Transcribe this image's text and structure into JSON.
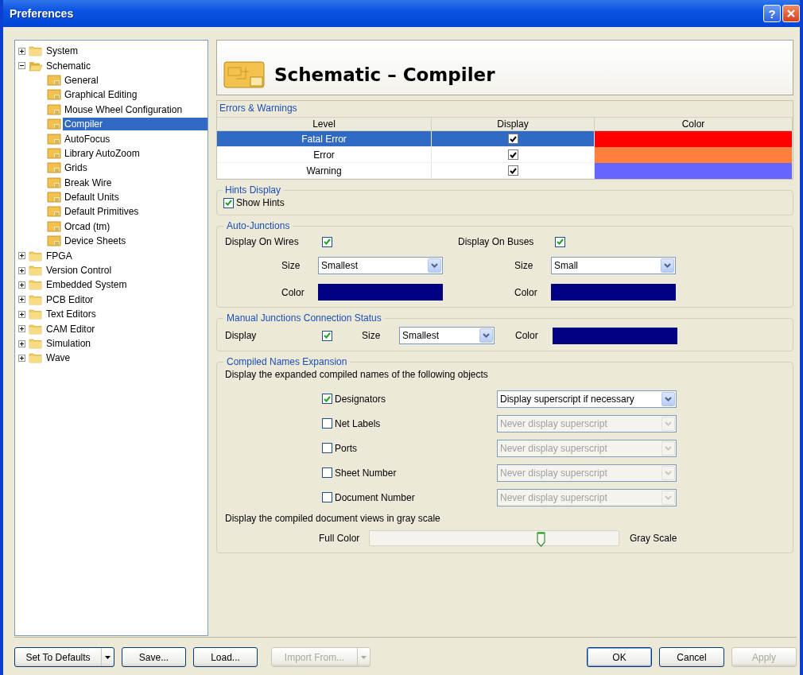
{
  "window": {
    "title": "Preferences",
    "help_label": "?"
  },
  "tree": [
    {
      "label": "System",
      "expanded": false,
      "selected": false
    },
    {
      "label": "Schematic",
      "expanded": true,
      "selected": false,
      "children": [
        {
          "label": "General",
          "selected": false
        },
        {
          "label": "Graphical Editing",
          "selected": false
        },
        {
          "label": "Mouse Wheel Configuration",
          "selected": false
        },
        {
          "label": "Compiler",
          "selected": true
        },
        {
          "label": "AutoFocus",
          "selected": false
        },
        {
          "label": "Library AutoZoom",
          "selected": false
        },
        {
          "label": "Grids",
          "selected": false
        },
        {
          "label": "Break Wire",
          "selected": false
        },
        {
          "label": "Default Units",
          "selected": false
        },
        {
          "label": "Default Primitives",
          "selected": false
        },
        {
          "label": "Orcad (tm)",
          "selected": false
        },
        {
          "label": "Device Sheets",
          "selected": false
        }
      ]
    },
    {
      "label": "FPGA",
      "expanded": false,
      "selected": false
    },
    {
      "label": "Version Control",
      "expanded": false,
      "selected": false
    },
    {
      "label": "Embedded System",
      "expanded": false,
      "selected": false
    },
    {
      "label": "PCB Editor",
      "expanded": false,
      "selected": false
    },
    {
      "label": "Text Editors",
      "expanded": false,
      "selected": false
    },
    {
      "label": "CAM Editor",
      "expanded": false,
      "selected": false
    },
    {
      "label": "Simulation",
      "expanded": false,
      "selected": false
    },
    {
      "label": "Wave",
      "expanded": false,
      "selected": false
    }
  ],
  "header": {
    "title": "Schematic – Compiler"
  },
  "errors": {
    "title": "Errors & Warnings",
    "columns": [
      "Level",
      "Display",
      "Color"
    ],
    "rows": [
      {
        "level": "Fatal Error",
        "display": true,
        "color": "#ff0000",
        "selected": true
      },
      {
        "level": "Error",
        "display": true,
        "color": "#ff7f3f",
        "selected": false
      },
      {
        "level": "Warning",
        "display": true,
        "color": "#6666ff",
        "selected": false
      }
    ]
  },
  "hints": {
    "title": "Hints Display",
    "label": "Show Hints",
    "checked": true
  },
  "auto_junctions": {
    "title": "Auto-Junctions",
    "sides": [
      {
        "label": "Display On Wires",
        "checked": true,
        "size_label": "Size",
        "size": "Smallest",
        "color_label": "Color",
        "color": "#000080"
      },
      {
        "label": "Display On Buses",
        "checked": true,
        "size_label": "Size",
        "size": "Small",
        "color_label": "Color",
        "color": "#000080"
      }
    ]
  },
  "manual_junctions": {
    "title": "Manual Junctions Connection Status",
    "label": "Display",
    "checked": true,
    "size_label": "Size",
    "size": "Smallest",
    "color_label": "Color",
    "color": "#000080"
  },
  "compiled_names": {
    "title": "Compiled Names Expansion",
    "description": "Display the expanded compiled names of the following objects",
    "objects": [
      {
        "label": "Designators",
        "checked": true,
        "option": "Display superscript if necessary",
        "disabled": false
      },
      {
        "label": "Net Labels",
        "checked": false,
        "option": "Never display superscript",
        "disabled": true
      },
      {
        "label": "Ports",
        "checked": false,
        "option": "Never display superscript",
        "disabled": true
      },
      {
        "label": "Sheet Number",
        "checked": false,
        "option": "Never display superscript",
        "disabled": true
      },
      {
        "label": "Document Number",
        "checked": false,
        "option": "Never display superscript",
        "disabled": true
      }
    ],
    "grayscale": {
      "description": "Display the compiled document views in gray scale",
      "left_label": "Full Color",
      "right_label": "Gray Scale",
      "level": 0.69
    }
  },
  "buttons_left": [
    {
      "label": "Set To Defaults",
      "menu": true,
      "disabled": false
    },
    {
      "label": "Save...",
      "menu": false,
      "disabled": false
    },
    {
      "label": "Load...",
      "menu": false,
      "disabled": false
    },
    {
      "label": "Import From...",
      "menu": true,
      "disabled": true
    }
  ],
  "buttons_right": [
    {
      "label": "OK",
      "menu": false,
      "disabled": false,
      "default": true
    },
    {
      "label": "Cancel",
      "menu": false,
      "disabled": false,
      "default": false
    },
    {
      "label": "Apply",
      "menu": false,
      "disabled": true,
      "default": false
    }
  ]
}
